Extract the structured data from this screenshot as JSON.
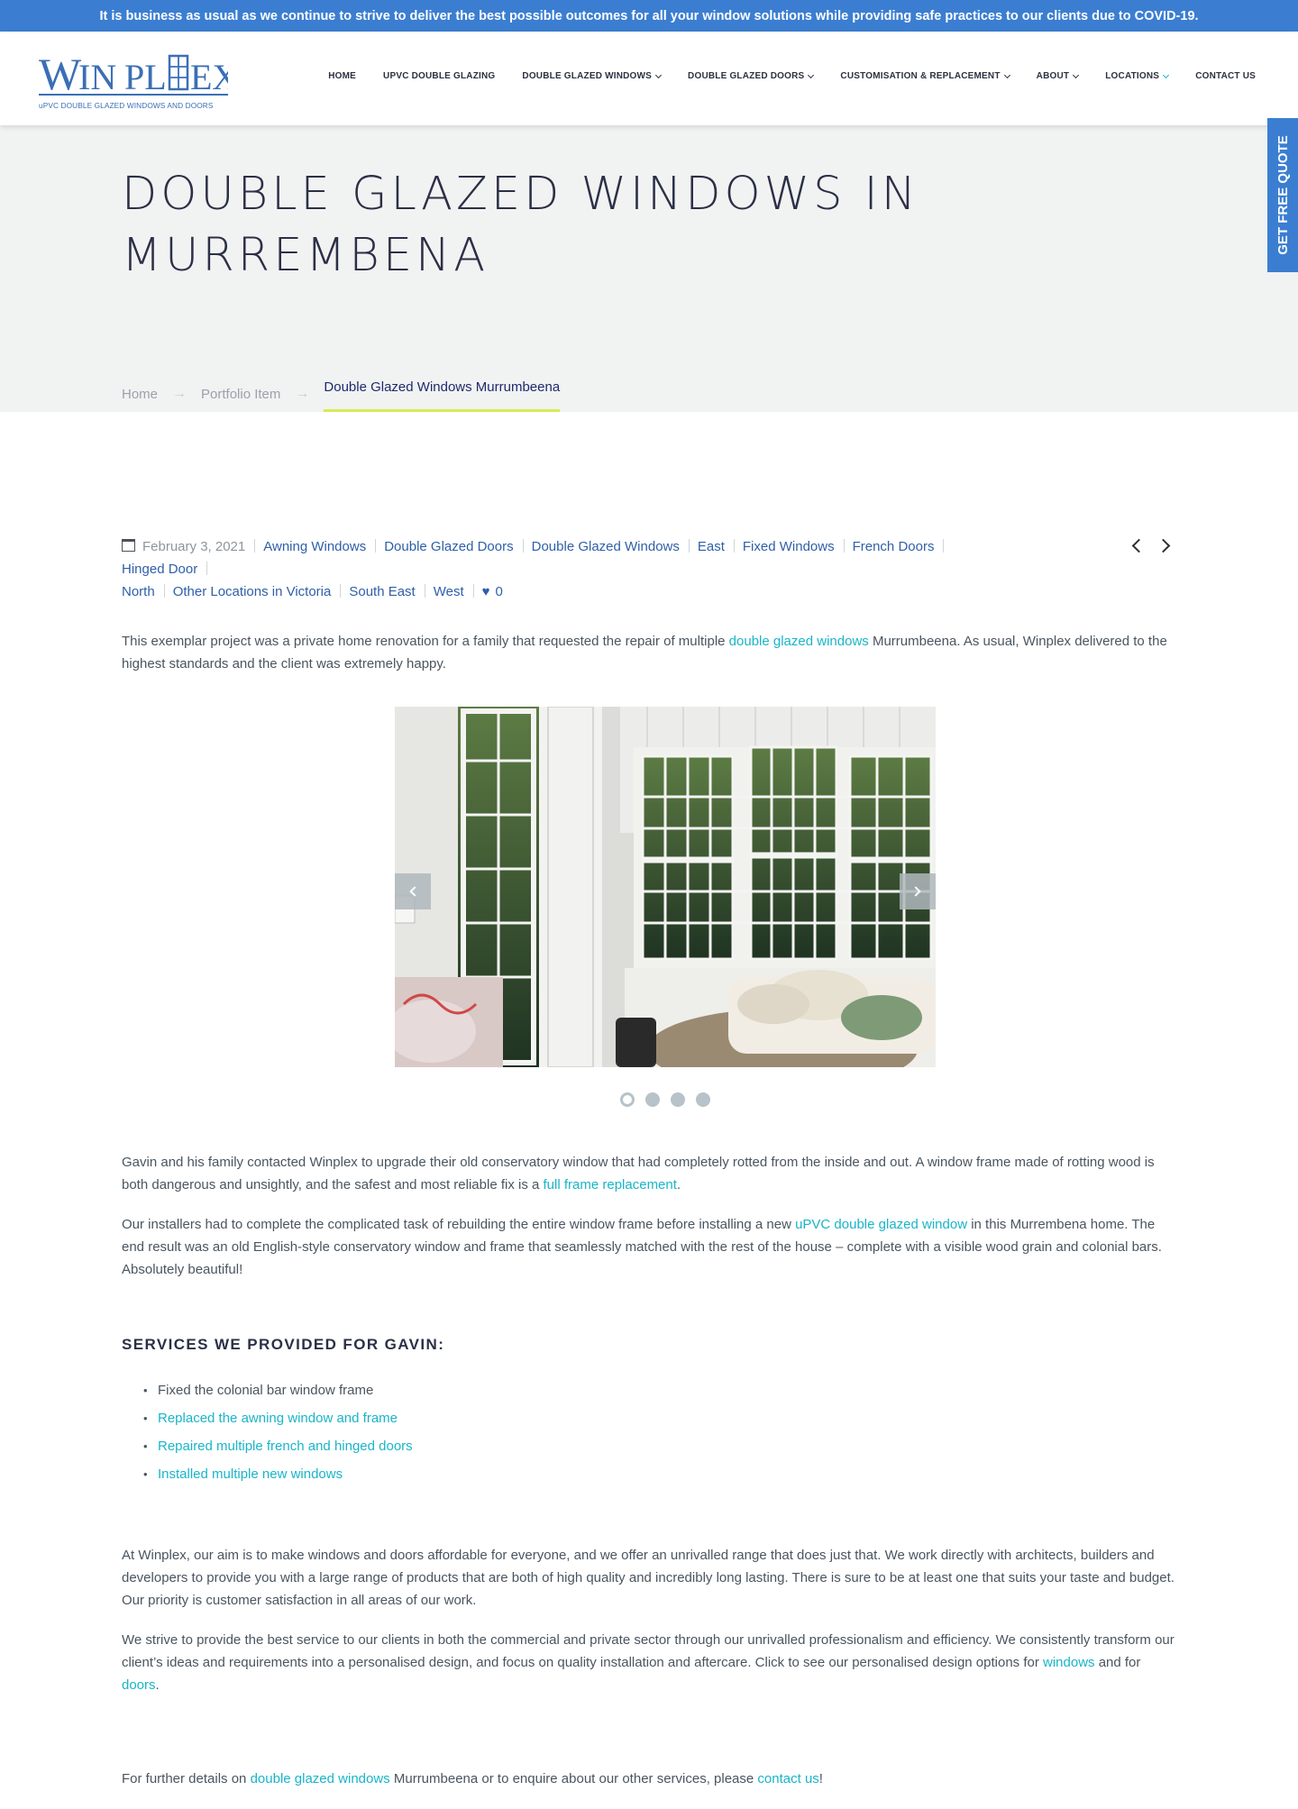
{
  "banner": {
    "text": "It is business as usual as we continue to strive to deliver the best possible outcomes for all your window solutions while providing safe practices to our clients due to COVID-19."
  },
  "logo": {
    "brand": "WINPLEX",
    "tagline": "uPVC DOUBLE GLAZED WINDOWS AND DOORS"
  },
  "nav": {
    "items": [
      {
        "label": "HOME"
      },
      {
        "label": "UPVC DOUBLE GLAZING"
      },
      {
        "label": "DOUBLE GLAZED WINDOWS"
      },
      {
        "label": "DOUBLE GLAZED DOORS"
      },
      {
        "label": "CUSTOMISATION & REPLACEMENT"
      },
      {
        "label": "ABOUT"
      },
      {
        "label": "LOCATIONS"
      },
      {
        "label": "CONTACT US"
      }
    ]
  },
  "quote_tab": {
    "label": "GET FREE QUOTE"
  },
  "hero": {
    "title": "DOUBLE GLAZED WINDOWS IN MURREMBENA"
  },
  "breadcrumb": {
    "home": "Home",
    "portfolio": "Portfolio Item",
    "current": "Double Glazed Windows Murrumbeena",
    "separator": "→"
  },
  "meta": {
    "date": "February 3, 2021",
    "categories": [
      "Awning Windows",
      "Double Glazed Doors",
      "Double Glazed Windows",
      "East",
      "Fixed Windows",
      "French Doors",
      "Hinged Door",
      "North",
      "Other Locations in Victoria",
      "South East",
      "West"
    ],
    "likes": "0"
  },
  "intro": {
    "before": "This exemplar project was a private home renovation for a family that requested the repair of multiple ",
    "link": "double glazed windows",
    "after": " Murrumbeena. As usual, Winplex delivered to the highest standards and the client was extremely happy."
  },
  "slider": {
    "total_slides": 4,
    "active_slide": 1
  },
  "para1": {
    "before": "Gavin and his family contacted Winplex to upgrade their old conservatory window that had completely rotted from the inside and out. A window frame made of rotting wood is both dangerous and unsightly, and the safest and most reliable fix is a ",
    "link": "full frame replacement",
    "after": "."
  },
  "para2": {
    "before": "Our installers had to complete the complicated task of rebuilding the entire window frame before installing a new ",
    "link": "uPVC double glazed window",
    "after": " in this Murrembena home. The end result was an old English-style conservatory window and frame that seamlessly matched with the rest of the house – complete with a visible wood grain and colonial bars. Absolutely beautiful!"
  },
  "services": {
    "heading": "SERVICES WE PROVIDED FOR GAVIN:",
    "items": [
      "Fixed the colonial bar window frame",
      "Replaced the awning window and frame",
      "Repaired multiple french and hinged doors",
      "Installed multiple new windows"
    ]
  },
  "para3": {
    "text": "At Winplex, our aim is to make windows and doors affordable for everyone, and we offer an unrivalled range that does just that. We work directly with architects, builders and developers to provide you with a large range of products that are both of high quality and incredibly long lasting. There is sure to be at least one that suits your taste and budget. Our priority is customer satisfaction in all areas of our work."
  },
  "para4": {
    "before": "We strive to provide the best service to our clients in both the commercial and private sector through our unrivalled professionalism and efficiency. We consistently transform our client’s ideas and requirements into a personalised design, and focus on quality installation and aftercare. Click to see our personalised design options for ",
    "link1": "windows",
    "middle": " and for ",
    "link2": "doors",
    "after": "."
  },
  "para5": {
    "before": "For further details on ",
    "link1": "double glazed windows",
    "middle": " Murrumbeena or to enquire about our other services, please ",
    "link2": "contact us",
    "after": "!"
  },
  "colors": {
    "banner_blue": "#3b7ed1",
    "link_cyan": "#19b5c8",
    "meta_blue": "#2f5fa8",
    "hero_bg": "#f1f2f2",
    "breadcrumb_underline": "#d7ec52"
  }
}
